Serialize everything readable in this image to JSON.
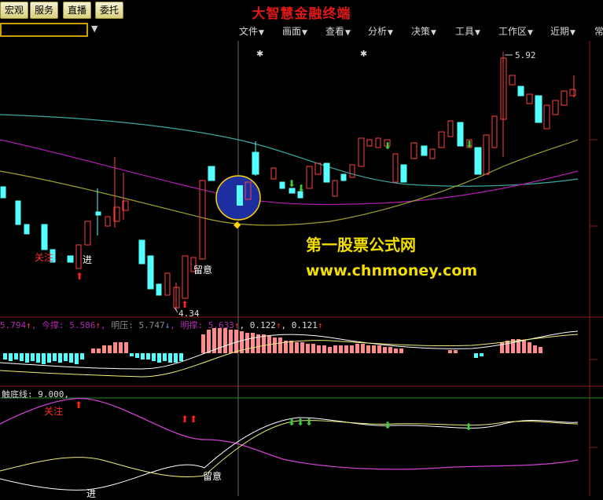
{
  "toolbar": {
    "buttons": [
      "宏观",
      "服务",
      "直播",
      "委托"
    ],
    "app_title": "大智慧金融终端"
  },
  "menus": [
    "文件",
    "画面",
    "查看",
    "分析",
    "决策",
    "工具",
    "工作区",
    "近期",
    "常"
  ],
  "main_chart": {
    "high_label": "5.92",
    "low_label": "4.34",
    "annotations": {
      "guanzhu": "关注",
      "jin": "进",
      "liuyi": "留意"
    }
  },
  "watermark": {
    "line1": "第一股票公式网",
    "line2": "www.chnmoney.com"
  },
  "indicator1": {
    "first": "5.794",
    "jincheng_label": "今撑:",
    "jincheng_value": "5.586",
    "mingya_label": "明压:",
    "mingya_value": "5.747",
    "mingcheng_label": "明撑:",
    "mingcheng_value": "5.633",
    "v1": "0.122",
    "v2": "0.121"
  },
  "indicator2": {
    "label": "触底线:",
    "value": "9.000,",
    "annotations": {
      "guanzhu": "关注",
      "jin": "进",
      "liuyi": "留意"
    }
  },
  "colors": {
    "up_candle": "#ff4040",
    "down_candle": "#54ffff",
    "ma_cyan": "#3aa8a0",
    "ma_purple": "#b01bb0",
    "ma_olive": "#a0a030",
    "title": "#e01818",
    "watermark": "#f2de00"
  },
  "icons": [
    "up-arrow-icon",
    "down-arrow-icon",
    "diamond-icon",
    "star-icon"
  ]
}
